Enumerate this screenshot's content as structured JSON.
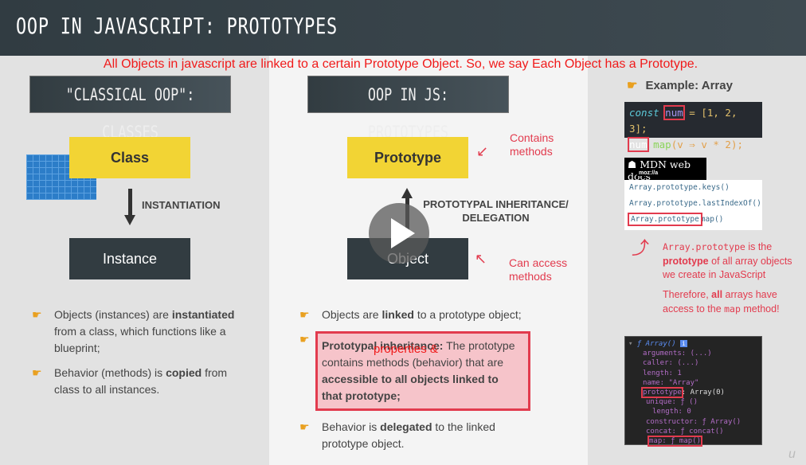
{
  "header": {
    "title": "OOP IN JAVASCRIPT: PROTOTYPES"
  },
  "annotation": "All Objects in javascript are linked to a certain Prototype Object. So, we say Each Object has a Prototype.",
  "left": {
    "tag": "\"CLASSICAL OOP\": CLASSES",
    "class_box": "Class",
    "instance_box": "Instance",
    "arrow_label": "INSTANTIATION",
    "bullets": [
      {
        "a": "Objects (instances) are ",
        "b": "instantiated",
        "c": " from a class, which functions like a blueprint;"
      },
      {
        "a": "Behavior (methods) is ",
        "b": "copied",
        "c": " from class to all instances."
      }
    ]
  },
  "middle": {
    "tag": "OOP IN JS: PROTOTYPES",
    "prototype_box": "Prototype",
    "object_box": "Object",
    "arrow_label": "PROTOTYPAL INHERITANCE/ DELEGATION",
    "contains": "Contains methods",
    "access": "Can access methods",
    "bullets": [
      {
        "a": "Objects are ",
        "b": "linked",
        "c": " to a prototype object;"
      },
      {
        "a": "Prototypal inheritance:",
        "b": " The prototype contains methods (behavior) that are ",
        "c": "accessible to all objects linked to that prototype;",
        "overlay": "properties &"
      },
      {
        "a": "Behavior is ",
        "b": "delegated",
        "c": " to the linked prototype object."
      }
    ]
  },
  "right": {
    "example_label": "Example: Array",
    "code": {
      "l1a": "const",
      "l1b": "num",
      "l1c": " = [1, 2, 3];",
      "l2a": "num",
      "l2b": ".",
      "l2c": "map",
      "l2d": "(v ⇒ v * 2);"
    },
    "mdn_logo": "MDN web docs",
    "mdn_sub": "moz://a",
    "mdn_items": [
      "Array.prototype.keys()",
      "Array.prototype.lastIndexOf()",
      "Array.prototype",
      "map()"
    ],
    "explain1a": "Array.prototype",
    "explain1b": " is the ",
    "explain1c": "prototype",
    "explain1d": " of all array objects we create in JavaScript",
    "explain2a": "Therefore, ",
    "explain2b": "all",
    "explain2c": " arrays have access to the ",
    "explain2d": "map",
    "explain2e": " method!",
    "devtools": [
      "ƒ Array()",
      "arguments: (...)",
      "caller: (...)",
      "length: 1",
      "name: \"Array\"",
      "prototype",
      "Array(0)",
      "unique: ƒ ()",
      "length: 0",
      "constructor: ƒ Array()",
      "concat: ƒ concat()",
      "map: ƒ map()"
    ]
  },
  "colors": {
    "accent_red": "#e23b4e",
    "yellow": "#f2d434",
    "dark": "#323c41"
  }
}
